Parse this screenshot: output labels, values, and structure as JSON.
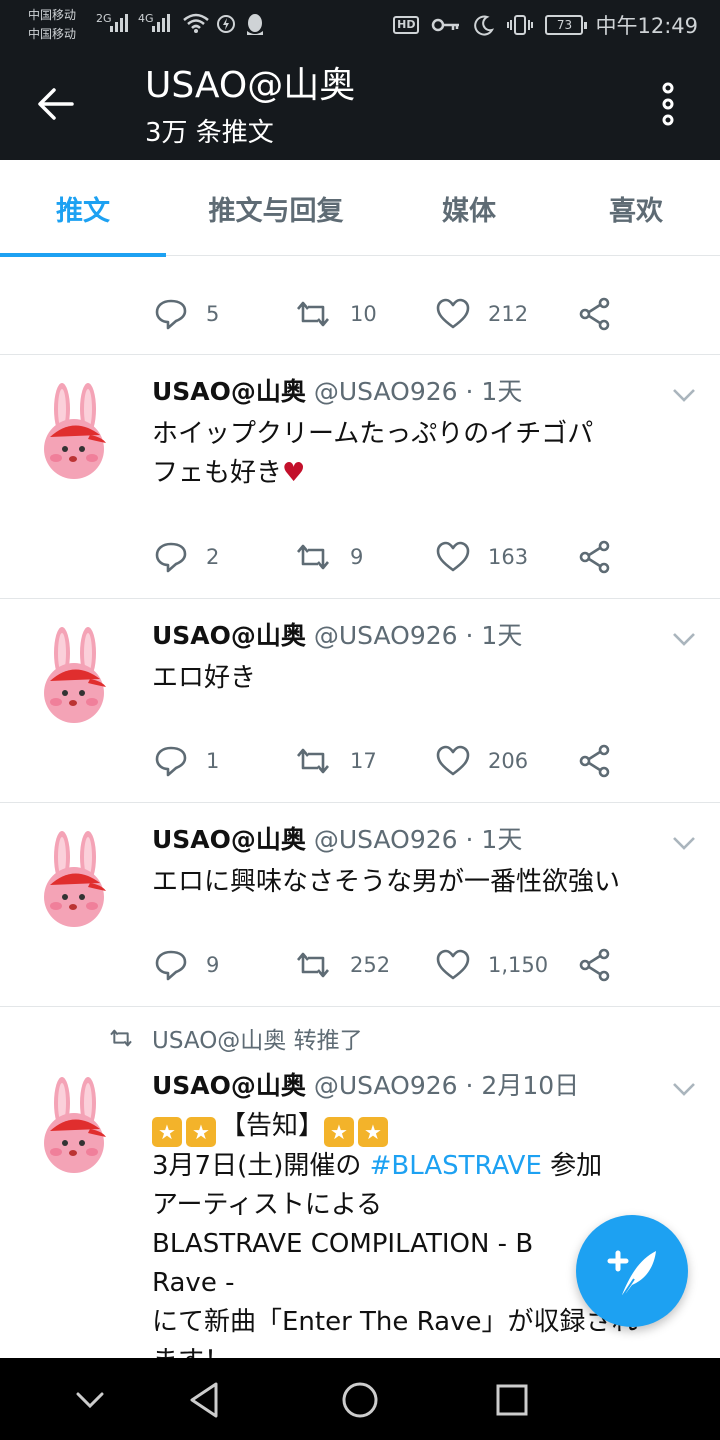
{
  "status_bar": {
    "carrier_1": "中国移动",
    "carrier_2": "中国移动",
    "network_1": "2G",
    "network_2": "4G",
    "hd": "HD",
    "battery": "73",
    "time": "中午12:49"
  },
  "header": {
    "title": "USAO@山奥",
    "subtitle": "3万 条推文"
  },
  "tabs": [
    {
      "label": "推文",
      "active": true
    },
    {
      "label": "推文与回复",
      "active": false
    },
    {
      "label": "媒体",
      "active": false
    },
    {
      "label": "喜欢",
      "active": false
    }
  ],
  "partial_tweet": {
    "replies": "5",
    "retweets": "10",
    "likes": "212"
  },
  "tweets": [
    {
      "name": "USAO@山奥",
      "handle": "@USAO926",
      "time": "· 1天",
      "text_line1": "ホイップクリームたっぷりのイチゴパ",
      "text_line2": "フェも好き",
      "emoji": "♥",
      "replies": "2",
      "retweets": "9",
      "likes": "163"
    },
    {
      "name": "USAO@山奥",
      "handle": "@USAO926",
      "time": "· 1天",
      "text": "エロ好き",
      "replies": "1",
      "retweets": "17",
      "likes": "206"
    },
    {
      "name": "USAO@山奥",
      "handle": "@USAO926",
      "time": "· 1天",
      "text": "エロに興味なさそうな男が一番性欲強い",
      "replies": "9",
      "retweets": "252",
      "likes": "1,150"
    }
  ],
  "retweet": {
    "retweeted_by": "USAO@山奥 转推了",
    "name": "USAO@山奥",
    "handle": "@USAO926",
    "time": "· 2月10日",
    "line1": "【告知】",
    "line2_pre": "3月7日(土)開催の ",
    "hashtag": "#BLASTRAVE",
    "line2_post": " 参加",
    "line3": "アーティストによる",
    "line4": "BLASTRAVE COMPILATION  - B",
    "line5": "Rave -",
    "line6": "にて新曲「Enter The Rave」が収録され",
    "line7": "ます！"
  },
  "colors": {
    "accent": "#1da1f2",
    "header_bg": "#15191d",
    "heart": "#c3102b"
  },
  "icons": [
    "back-arrow-icon",
    "more-vertical-icon",
    "reply-icon",
    "retweet-icon",
    "like-icon",
    "share-icon",
    "caret-down-icon",
    "compose-tweet-icon"
  ]
}
